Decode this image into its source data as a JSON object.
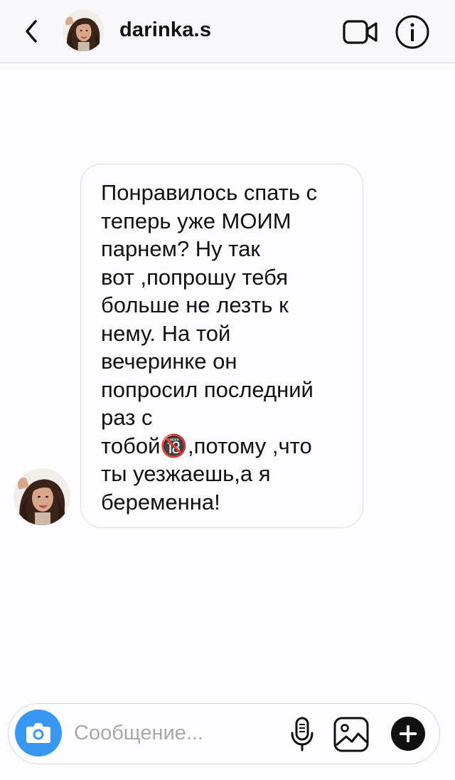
{
  "header": {
    "username": "darinka.s",
    "icons": {
      "back": "chevron-left-icon",
      "video": "video-camera-icon",
      "info": "info-icon"
    }
  },
  "message": {
    "lines": [
      "Понравилось спать с",
      "теперь уже МОИМ",
      "парнем? Ну так",
      "вот ,попрошу тебя",
      "больше не лезть к",
      "нему. На той",
      "вечеринке он",
      "попросил последний",
      "раз с",
      "тобой🔞,потому ,что",
      "ты уезжаешь,а я",
      "беременна!"
    ]
  },
  "composer": {
    "placeholder": "Сообщение...",
    "value": "",
    "icons": {
      "camera": "camera-icon",
      "mic": "microphone-icon",
      "gallery": "gallery-icon",
      "plus": "plus-icon"
    }
  },
  "colors": {
    "accent": "#3897f0",
    "header_bg": "#f8f7f9",
    "bubble_border": "#dedde1",
    "text": "#111111"
  }
}
